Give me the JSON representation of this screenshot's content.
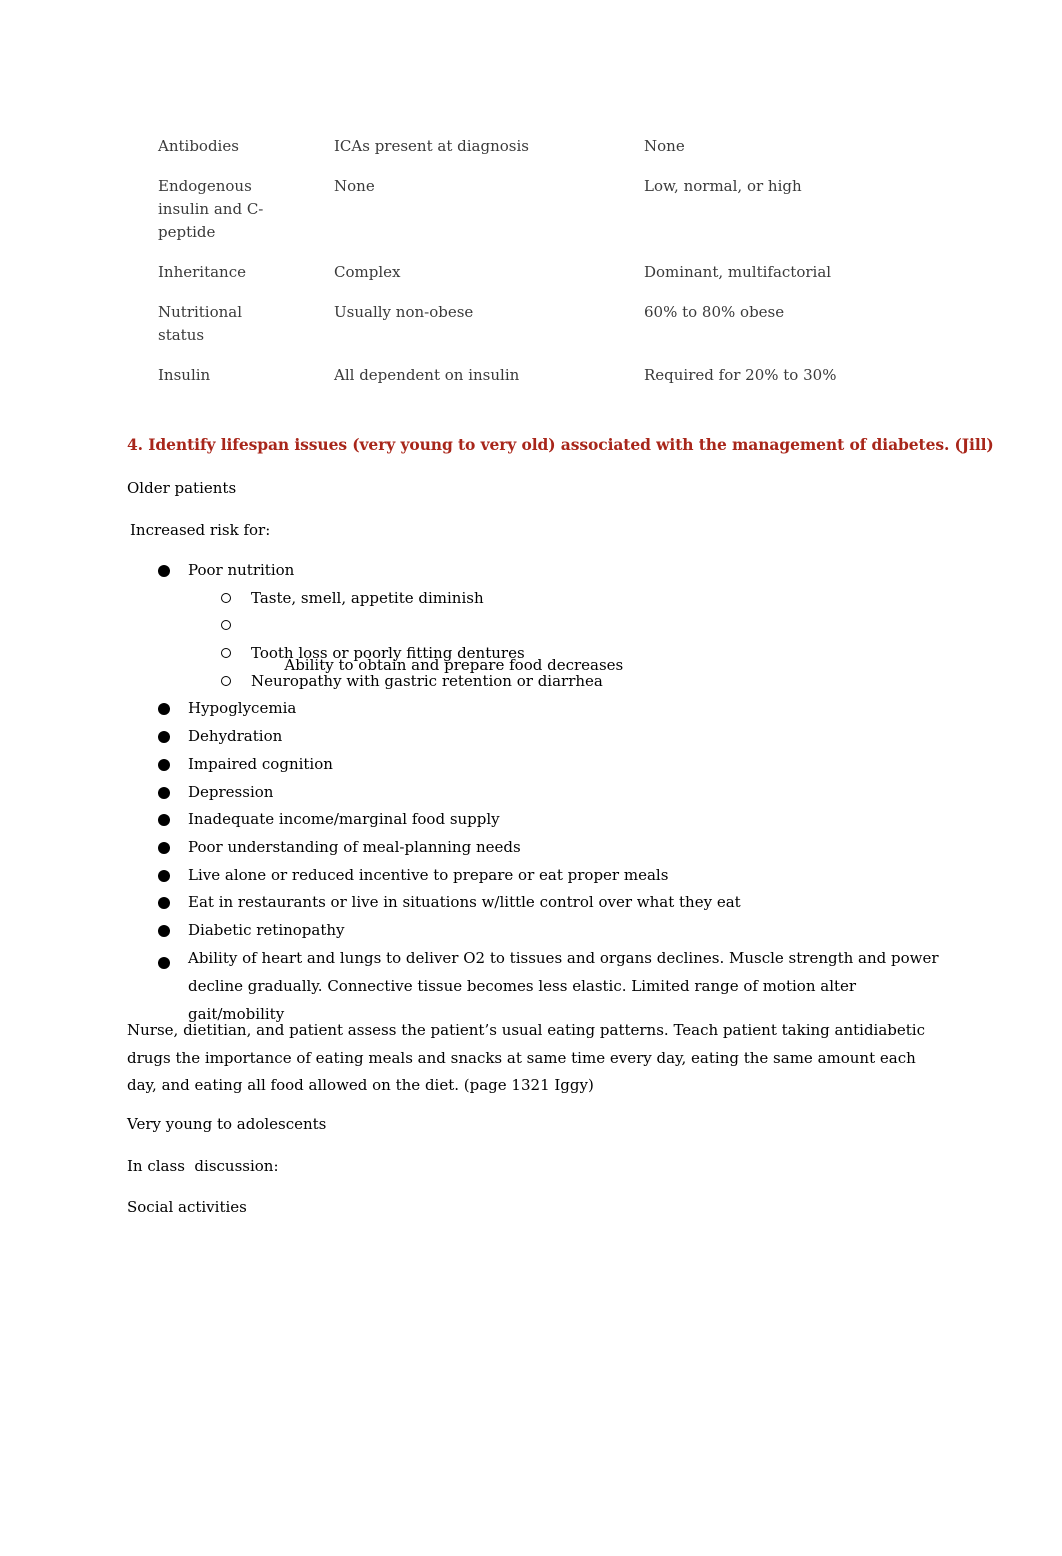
{
  "table": {
    "rows": [
      {
        "label": [
          "Antibodies"
        ],
        "type1": [
          "ICAs present at diagnosis"
        ],
        "type2": [
          "None"
        ]
      },
      {
        "label": [
          "Endogenous",
          "insulin and C-",
          "peptide"
        ],
        "type1": [
          "None"
        ],
        "type2": [
          "Low, normal, or high"
        ]
      },
      {
        "label": [
          "Inheritance"
        ],
        "type1": [
          "Complex"
        ],
        "type2": [
          "Dominant, multifactorial"
        ]
      },
      {
        "label": [
          "Nutritional",
          "status"
        ],
        "type1": [
          "Usually non-obese"
        ],
        "type2": [
          "60% to 80% obese"
        ]
      },
      {
        "label": [
          "Insulin"
        ],
        "type1": [
          "All dependent on insulin"
        ],
        "type2": [
          "Required for 20% to 30%"
        ]
      }
    ]
  },
  "section": {
    "heading": "4. Identify lifespan issues (very young to very old) associated with the management of diabetes. (Jill)",
    "heading_color": "#a8261a",
    "older_patients": "Older patients",
    "increased_risk": "Increased risk for:",
    "poor_nutrition": "Poor nutrition",
    "poor_nutrition_sub": [
      "Taste, smell, appetite diminish",
      " Ability to obtain and prepare food decreases",
      "Tooth loss or poorly fitting dentures",
      "Neuropathy with gastric retention or diarrhea"
    ],
    "risks": [
      "Hypoglycemia",
      "Dehydration",
      "Impaired cognition",
      "Depression",
      "Inadequate income/marginal food supply",
      "Poor understanding of meal-planning needs",
      "Live alone or reduced incentive to prepare or eat proper meals",
      "Eat in restaurants or live in situations w/little control over what they eat",
      "Diabetic retinopathy"
    ],
    "last_risk": "Ability of heart and lungs to deliver O2 to tissues and organs declines. Muscle strength and power decline gradually. Connective tissue becomes less elastic. Limited range of motion alter gait/mobility",
    "paragraph": "Nurse, dietitian, and patient assess the patient’s usual eating patterns. Teach patient taking antidiabetic drugs the importance of eating meals and snacks at same time every day, eating the same amount each day, and eating all food allowed on the diet.  (page 1321 Iggy)",
    "very_young": "Very young to adolescents",
    "in_class": "In class  discussion:",
    "social": "Social activities"
  }
}
